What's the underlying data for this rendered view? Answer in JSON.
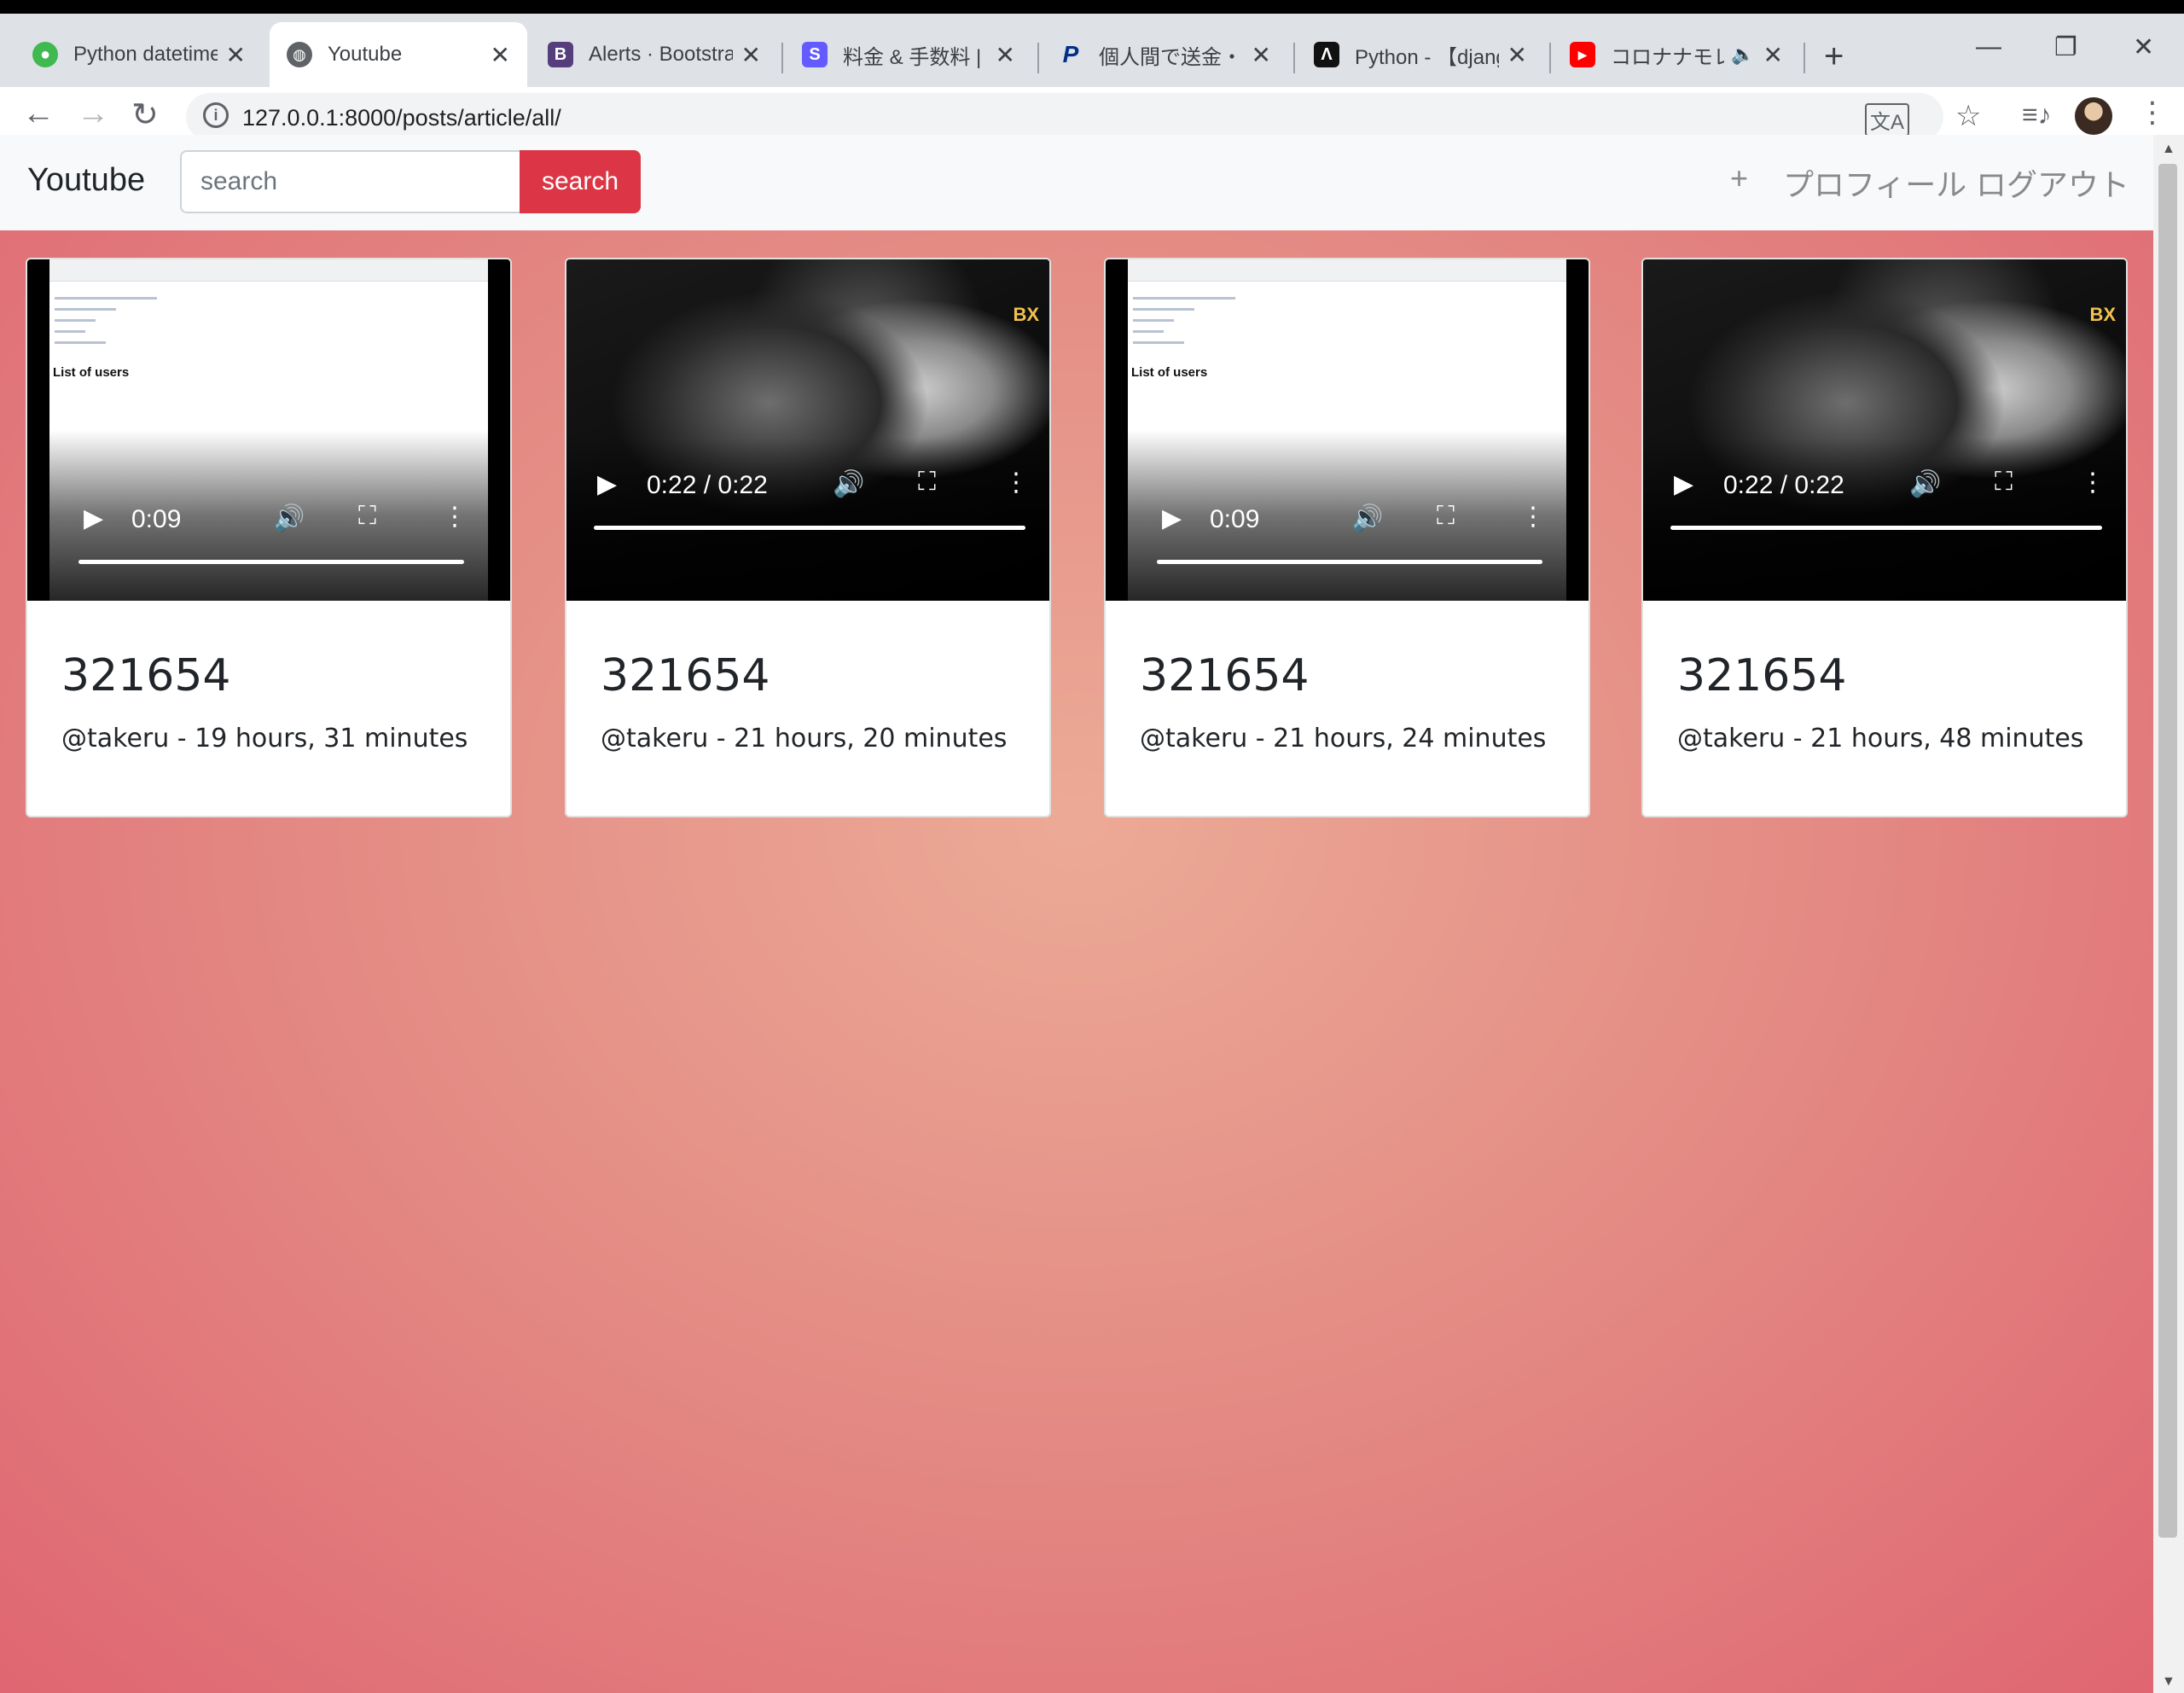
{
  "browser": {
    "tabs": [
      {
        "title": "Python datetime",
        "icon": "python-icon",
        "active": false
      },
      {
        "title": "Youtube",
        "icon": "globe-icon",
        "active": true
      },
      {
        "title": "Alerts · Bootstra",
        "icon": "bootstrap-icon",
        "active": false
      },
      {
        "title": "料金 & 手数料 |",
        "icon": "stripe-icon",
        "active": false
      },
      {
        "title": "個人間で送金・集",
        "icon": "paypal-icon",
        "active": false
      },
      {
        "title": "Python - 【djang",
        "icon": "atcoder-icon",
        "active": false
      },
      {
        "title": "コロナナモレモ",
        "icon": "youtube-icon",
        "active": false
      }
    ],
    "url": "127.0.0.1:8000/posts/article/all/",
    "colors": {
      "tabstrip": "#dee1e6",
      "accent": "#dc3545"
    }
  },
  "site": {
    "brand": "Youtube",
    "search_placeholder": "search",
    "search_button": "search",
    "add_label": "+",
    "profile_link": "プロフィール",
    "logout_link": "ログアウト"
  },
  "posts": [
    {
      "title": "321654",
      "meta": "@takeru - 19 hours, 31 minutes",
      "video_time": "0:09",
      "variant": "screen-recording"
    },
    {
      "title": "321654",
      "meta": "@takeru - 21 hours, 20 minutes",
      "video_time": "0:22 / 0:22",
      "variant": "band-footage"
    },
    {
      "title": "321654",
      "meta": "@takeru - 21 hours, 24 minutes",
      "video_time": "0:09",
      "variant": "screen-recording"
    },
    {
      "title": "321654",
      "meta": "@takeru - 21 hours, 48 minutes",
      "video_time": "0:22 / 0:22",
      "variant": "band-footage"
    }
  ],
  "video_thumb": {
    "caption": "List of users",
    "logo": "BX"
  }
}
